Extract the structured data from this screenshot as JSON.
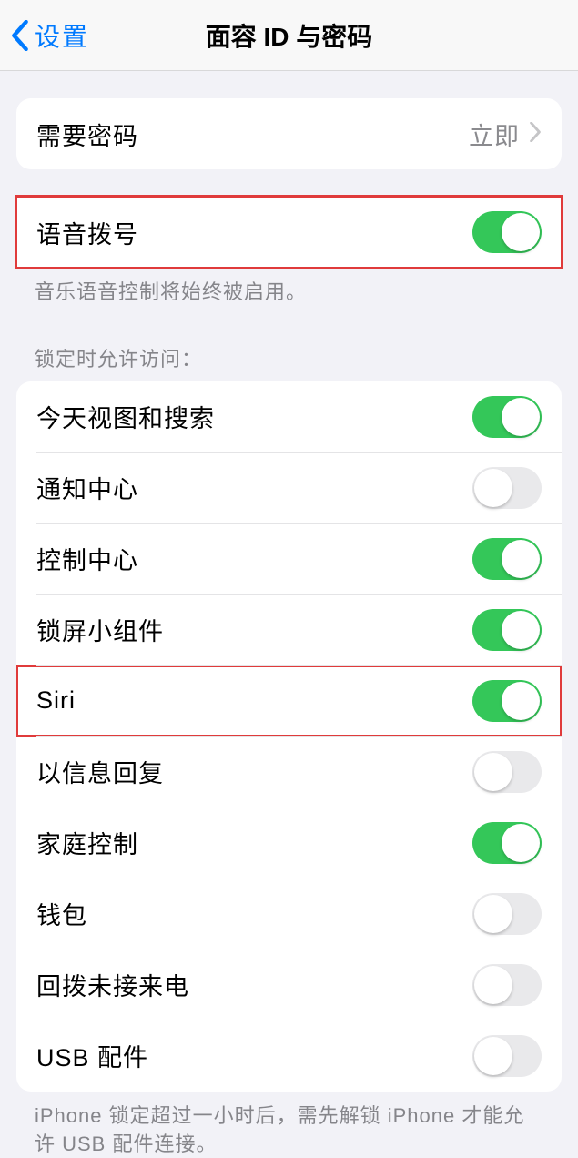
{
  "nav": {
    "back": "设置",
    "title": "面容 ID 与密码"
  },
  "passcode": {
    "label": "需要密码",
    "value": "立即"
  },
  "voiceDial": {
    "label": "语音拨号",
    "note": "音乐语音控制将始终被启用。"
  },
  "lockedAccess": {
    "header": "锁定时允许访问：",
    "items": [
      {
        "label": "今天视图和搜索",
        "on": true
      },
      {
        "label": "通知中心",
        "on": false
      },
      {
        "label": "控制中心",
        "on": true
      },
      {
        "label": "锁屏小组件",
        "on": true
      },
      {
        "label": "Siri",
        "on": true
      },
      {
        "label": "以信息回复",
        "on": false
      },
      {
        "label": "家庭控制",
        "on": true
      },
      {
        "label": "钱包",
        "on": false
      },
      {
        "label": "回拨未接来电",
        "on": false
      },
      {
        "label": "USB 配件",
        "on": false
      }
    ],
    "footer": "iPhone 锁定超过一小时后，需先解锁 iPhone 才能允许 USB 配件连接。"
  }
}
